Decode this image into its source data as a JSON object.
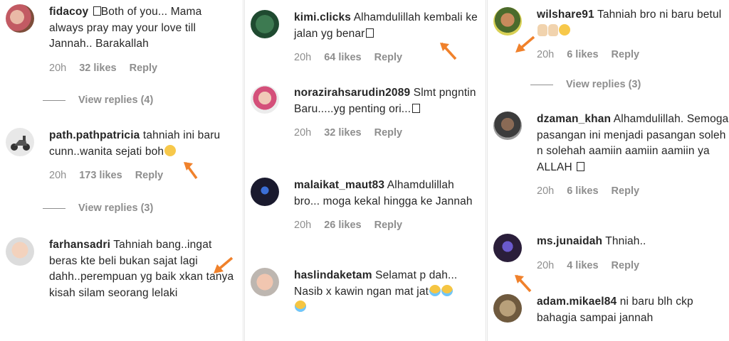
{
  "panel1": {
    "comments": [
      {
        "username": "fidacoy",
        "text": "Both of you... Mama always pray may your love till Jannah.. Barakallah",
        "time": "20h",
        "likes": "32 likes",
        "reply": "Reply",
        "view_replies": "View replies (4)"
      },
      {
        "username": "path.pathpatricia",
        "text": "tahniah ini baru cunn..wanita sejati boh",
        "time": "20h",
        "likes": "173 likes",
        "reply": "Reply",
        "view_replies": "View replies (3)"
      },
      {
        "username": "farhansadri",
        "text": "Tahniah bang..ingat beras kte beli bukan sajat lagi dahh..perempuan yg baik xkan tanya kisah silam seorang lelaki"
      }
    ]
  },
  "panel2": {
    "comments": [
      {
        "username": "kimi.clicks",
        "text": "Alhamdulillah kembali ke jalan yg benar",
        "time": "20h",
        "likes": "64 likes",
        "reply": "Reply"
      },
      {
        "username": "norazirahsarudin2089",
        "text": "Slmt pngntin Baru.....yg penting ori...",
        "time": "20h",
        "likes": "32 likes",
        "reply": "Reply"
      },
      {
        "username": "malaikat_maut83",
        "text": "Alhamdulillah bro... moga kekal hingga ke Jannah",
        "time": "20h",
        "likes": "26 likes",
        "reply": "Reply"
      },
      {
        "username": "haslindaketam",
        "text": "Selamat p dah... Nasib x kawin ngan mat jat"
      }
    ]
  },
  "panel3": {
    "comments": [
      {
        "username": "wilshare91",
        "text": "Tahniah bro ni baru betul",
        "time": "20h",
        "likes": "6 likes",
        "reply": "Reply",
        "view_replies": "View replies (3)"
      },
      {
        "username": "dzaman_khan",
        "text": "Alhamdulillah. Semoga pasangan ini menjadi pasangan soleh n solehah aamiin aamiin aamiin ya ALLAH",
        "time": "20h",
        "likes": "6 likes",
        "reply": "Reply"
      },
      {
        "username": "ms.junaidah",
        "text": "Thniah..",
        "time": "20h",
        "likes": "4 likes",
        "reply": "Reply"
      },
      {
        "username": "adam.mikael84",
        "text": "ni baru blh ckp bahagia sampai jannah"
      }
    ]
  },
  "colors": {
    "arrow": "#f0812b",
    "meta_text": "#8e8e8e",
    "text": "#262626"
  }
}
